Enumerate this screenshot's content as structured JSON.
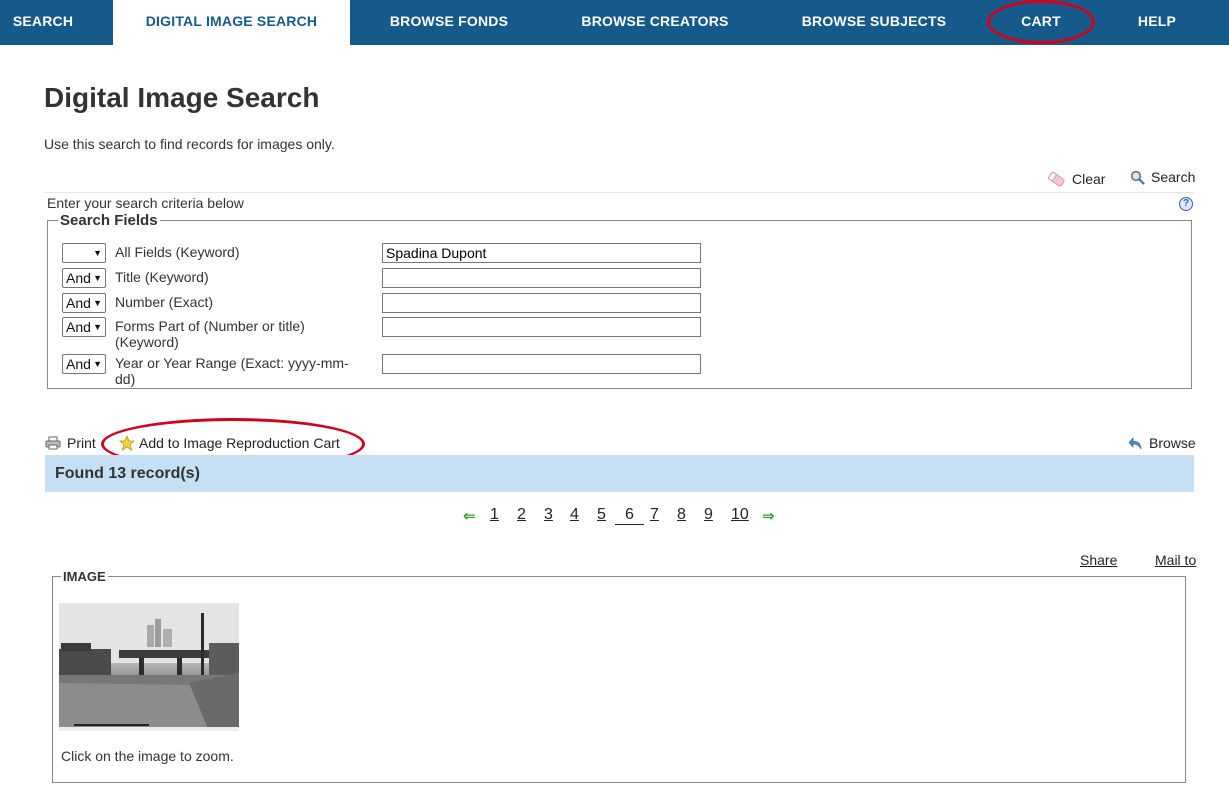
{
  "nav": {
    "items": [
      {
        "label": "SEARCH",
        "active": false
      },
      {
        "label": "DIGITAL IMAGE SEARCH",
        "active": true
      },
      {
        "label": "BROWSE FONDS",
        "active": false
      },
      {
        "label": "BROWSE CREATORS",
        "active": false
      },
      {
        "label": "BROWSE SUBJECTS",
        "active": false
      },
      {
        "label": "CART",
        "active": false
      },
      {
        "label": "HELP",
        "active": false
      }
    ]
  },
  "page": {
    "title": "Digital Image Search",
    "intro": "Use this search to find records for images only."
  },
  "toolbar": {
    "clear_label": "Clear",
    "search_label": "Search"
  },
  "criteria_text": "Enter your search criteria below",
  "search_fields": {
    "legend": "Search Fields",
    "rows": [
      {
        "operator": "",
        "label": "All Fields  (Keyword)",
        "value": "Spadina Dupont"
      },
      {
        "operator": "And",
        "label": "Title  (Keyword)",
        "value": ""
      },
      {
        "operator": "And",
        "label": "Number  (Exact)",
        "value": ""
      },
      {
        "operator": "And",
        "label": "Forms Part of (Number or title) (Keyword)",
        "value": ""
      },
      {
        "operator": "And",
        "label": "Year or Year Range  (Exact: yyyy-mm-dd)",
        "value": ""
      }
    ]
  },
  "actions": {
    "print_label": "Print",
    "cart_label": "Add to Image Reproduction Cart",
    "browse_label": "Browse"
  },
  "results": {
    "found_text": "Found 13 record(s)",
    "pages": [
      "1",
      "2",
      "3",
      "4",
      "5",
      "6",
      "7",
      "8",
      "9",
      "10"
    ],
    "current_page": "6"
  },
  "record": {
    "share_label": "Share",
    "mailto_label": "Mail to",
    "legend": "IMAGE",
    "zoom_note": "Click on the image to zoom."
  },
  "colors": {
    "nav_bg": "#155a8a",
    "results_bg": "#c6dff3",
    "highlight_ring": "#d0021b",
    "pager_arrow": "#2e9b2e"
  }
}
